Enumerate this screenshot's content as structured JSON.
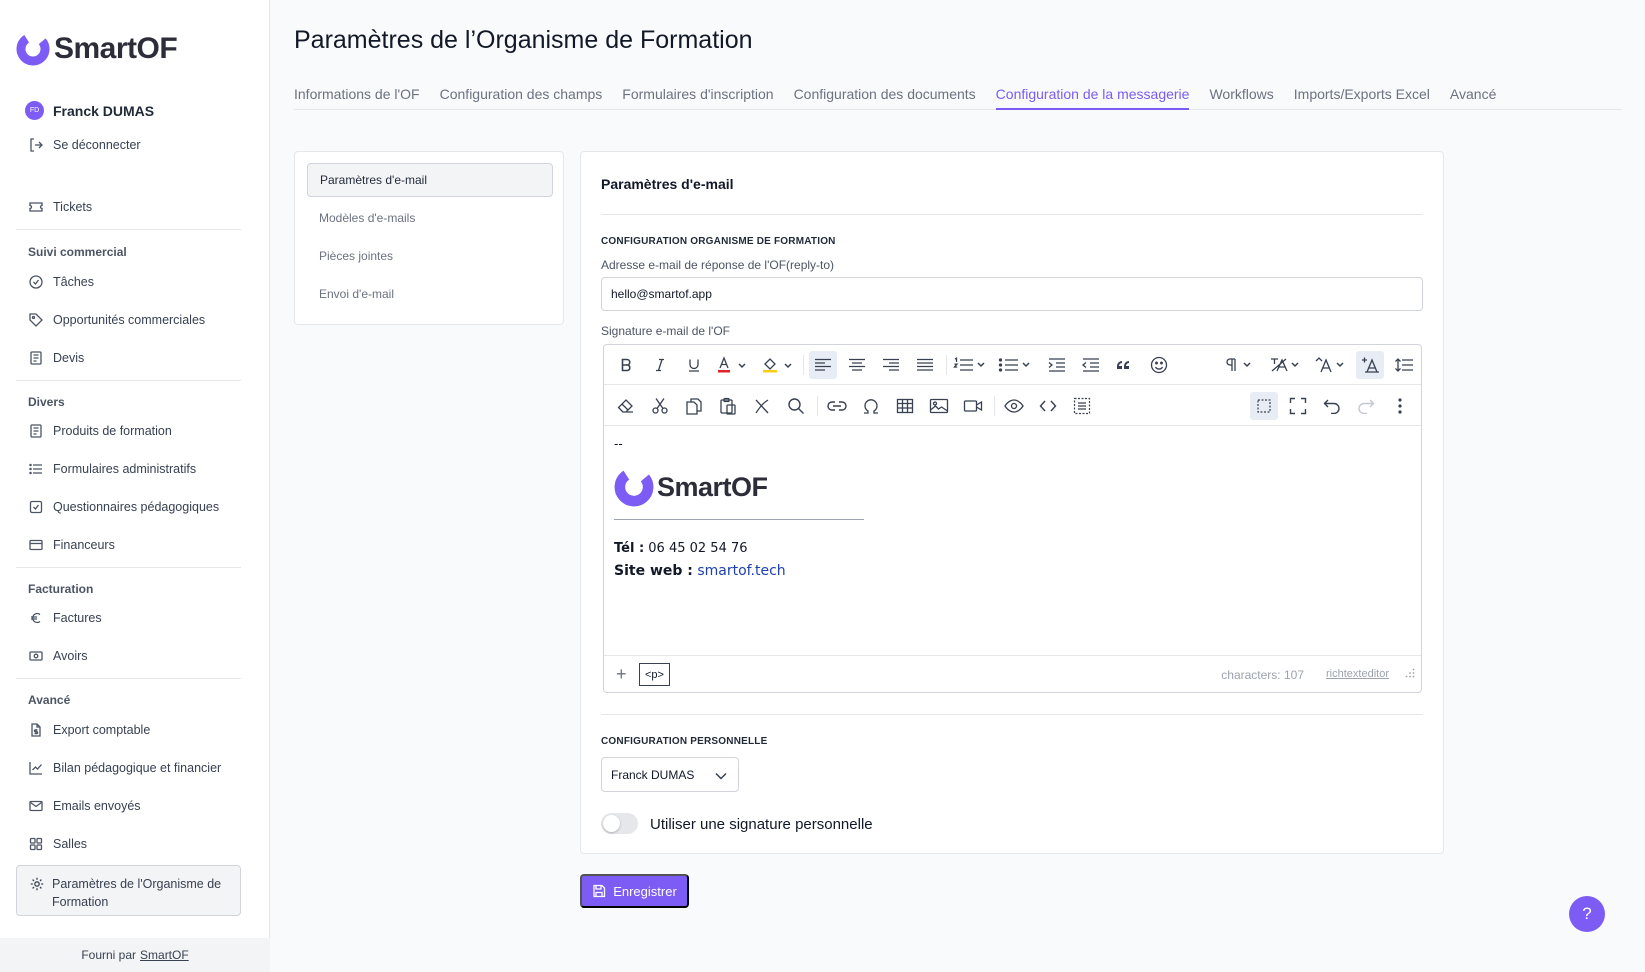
{
  "colors": {
    "accent": "#7c5cf5",
    "link": "#1e40af"
  },
  "brand": {
    "logo_text": "SmartOF"
  },
  "user": {
    "initials": "FD",
    "name": "Franck DUMAS"
  },
  "sidebar": {
    "logout": "Se déconnecter",
    "tickets": "Tickets",
    "sections": {
      "commercial": "Suivi commercial",
      "divers": "Divers",
      "facturation": "Facturation",
      "avance": "Avancé"
    },
    "items": {
      "taches": "Tâches",
      "opportunites": "Opportunités commerciales",
      "devis": "Devis",
      "produits": "Produits de formation",
      "formulaires": "Formulaires administratifs",
      "questionnaires": "Questionnaires pédagogiques",
      "financeurs": "Financeurs",
      "factures": "Factures",
      "avoirs": "Avoirs",
      "export": "Export comptable",
      "bilan": "Bilan pédagogique et financier",
      "emails": "Emails envoyés",
      "salles": "Salles",
      "parametres": "Paramètres de l'Organisme de Formation"
    },
    "footer_prefix": "Fourni par",
    "footer_link": "SmartOF"
  },
  "page": {
    "title": "Paramètres de l’Organisme de Formation"
  },
  "tabs": [
    {
      "label": "Informations de l'OF"
    },
    {
      "label": "Configuration des champs"
    },
    {
      "label": "Formulaires d'inscription"
    },
    {
      "label": "Configuration des documents"
    },
    {
      "label": "Configuration de la messagerie",
      "active": true
    },
    {
      "label": "Workflows"
    },
    {
      "label": "Imports/Exports Excel"
    },
    {
      "label": "Avancé"
    }
  ],
  "submenu": [
    {
      "label": "Paramètres d'e-mail",
      "active": true
    },
    {
      "label": "Modèles d'e-mails"
    },
    {
      "label": "Pièces jointes"
    },
    {
      "label": "Envoi d'e-mail"
    }
  ],
  "panel": {
    "title": "Paramètres d'e-mail",
    "org_section": "CONFIGURATION ORGANISME DE FORMATION",
    "reply_label": "Adresse e-mail de réponse de l'OF(reply-to)",
    "reply_value": "hello@smartof.app",
    "signature_label": "Signature e-mail de l'OF",
    "signature": {
      "dash": "--",
      "logo_text": "SmartOF",
      "tel_label": "Tél :",
      "tel_value": "06 45 02 54 76",
      "web_label": "Site web :",
      "web_value": "smartof.tech"
    },
    "editor_status": {
      "plus": "+",
      "tag": "<p>",
      "chars": "characters: 107",
      "brand": "richtexteditor"
    },
    "personal_section": "CONFIGURATION PERSONNELLE",
    "personal_select": "Franck DUMAS",
    "toggle_label": "Utiliser une signature personnelle",
    "toggle_on": false
  },
  "save_label": "Enregistrer",
  "help_label": "?"
}
